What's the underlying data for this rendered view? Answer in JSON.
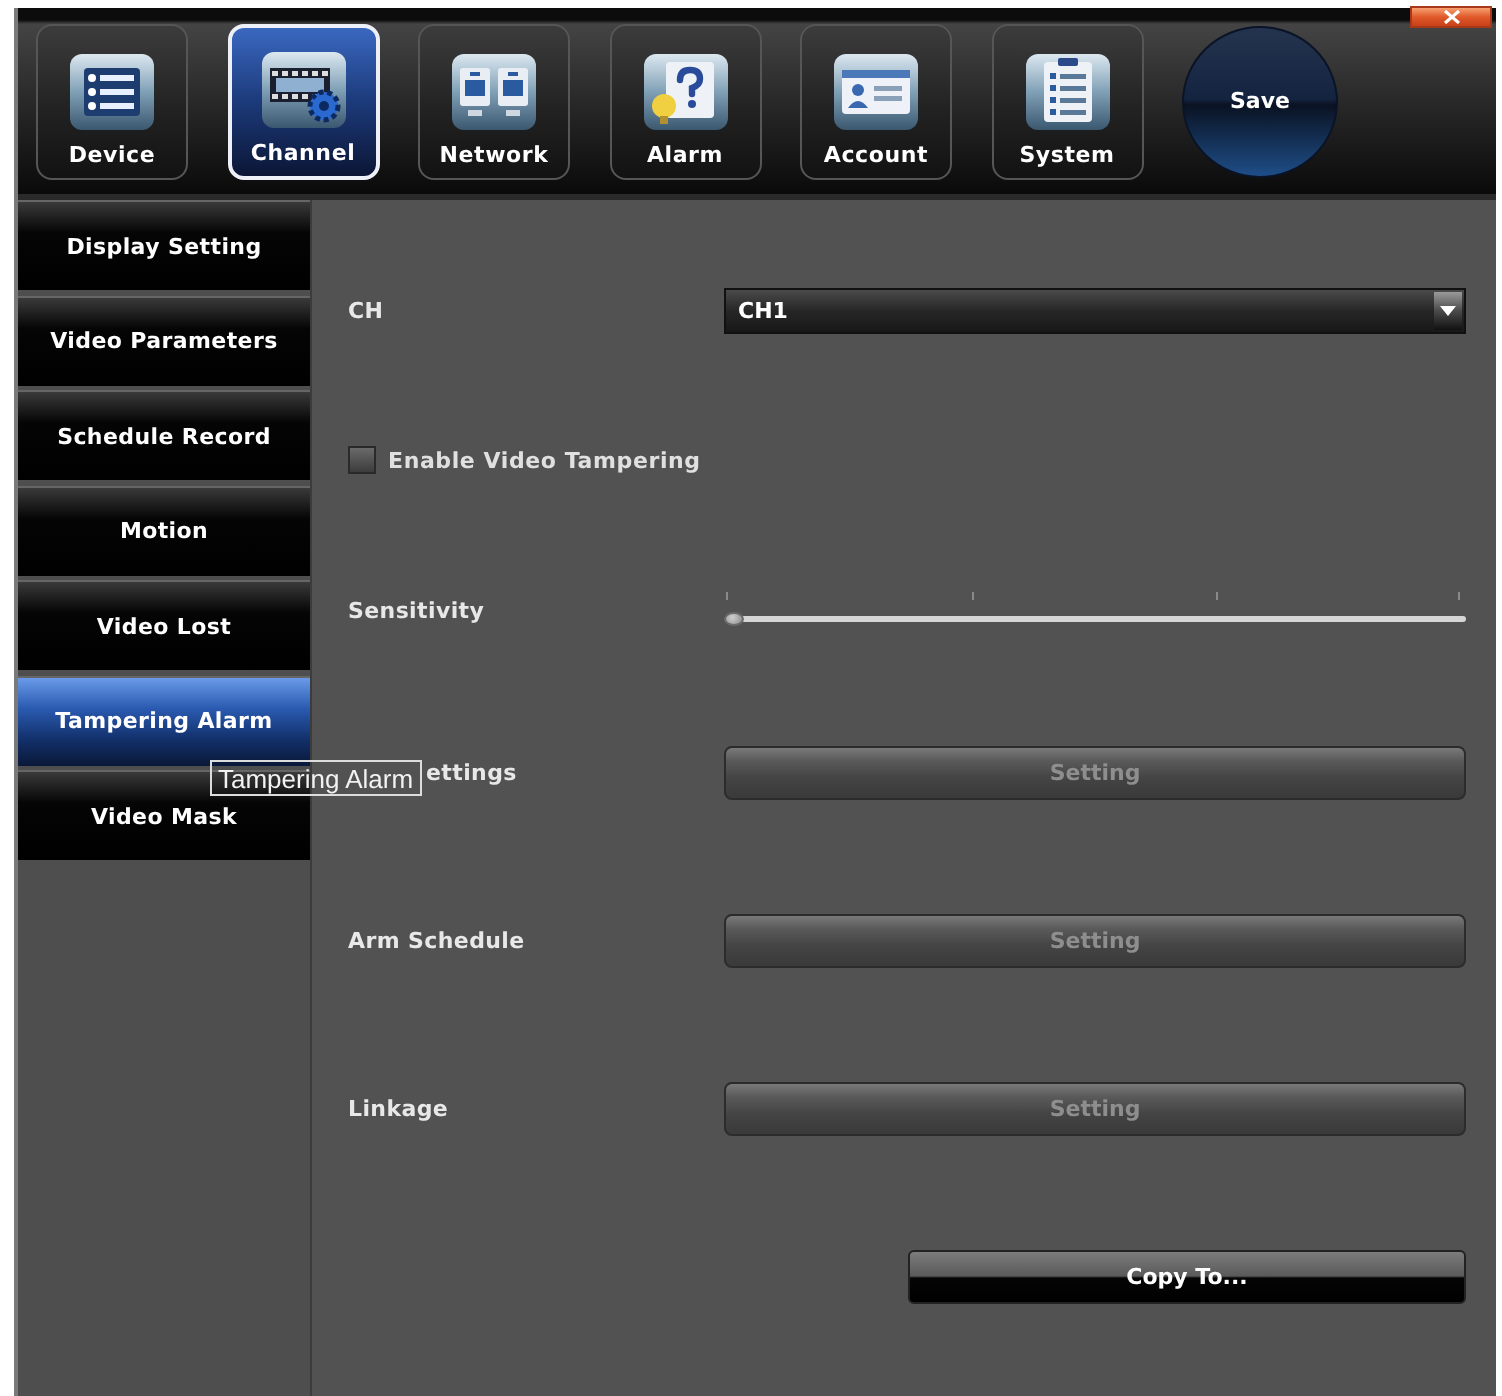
{
  "toolbar": {
    "tabs": [
      {
        "label": "Device",
        "selected": false
      },
      {
        "label": "Channel",
        "selected": true
      },
      {
        "label": "Network",
        "selected": false
      },
      {
        "label": "Alarm",
        "selected": false
      },
      {
        "label": "Account",
        "selected": false
      },
      {
        "label": "System",
        "selected": false
      }
    ],
    "save_button": "Save"
  },
  "sidebar": {
    "items": [
      {
        "label": "Display Setting",
        "selected": false
      },
      {
        "label": "Video Parameters",
        "selected": false
      },
      {
        "label": "Schedule Record",
        "selected": false
      },
      {
        "label": "Motion",
        "selected": false
      },
      {
        "label": "Video Lost",
        "selected": false
      },
      {
        "label": "Tampering Alarm",
        "selected": true
      },
      {
        "label": "Video Mask",
        "selected": false
      }
    ]
  },
  "tooltip": "Tampering Alarm",
  "form": {
    "channel": {
      "label": "CH",
      "value": "CH1"
    },
    "enable_tampering": {
      "label": "Enable Video Tampering",
      "checked": false
    },
    "sensitivity": {
      "label": "Sensitivity",
      "level": 0
    },
    "setting_rows": [
      {
        "label": "ettings",
        "button": "Setting",
        "disabled": true
      },
      {
        "label": "Arm Schedule",
        "button": "Setting",
        "disabled": true
      },
      {
        "label": "Linkage",
        "button": "Setting",
        "disabled": true
      }
    ],
    "copy_button": "Copy To..."
  }
}
